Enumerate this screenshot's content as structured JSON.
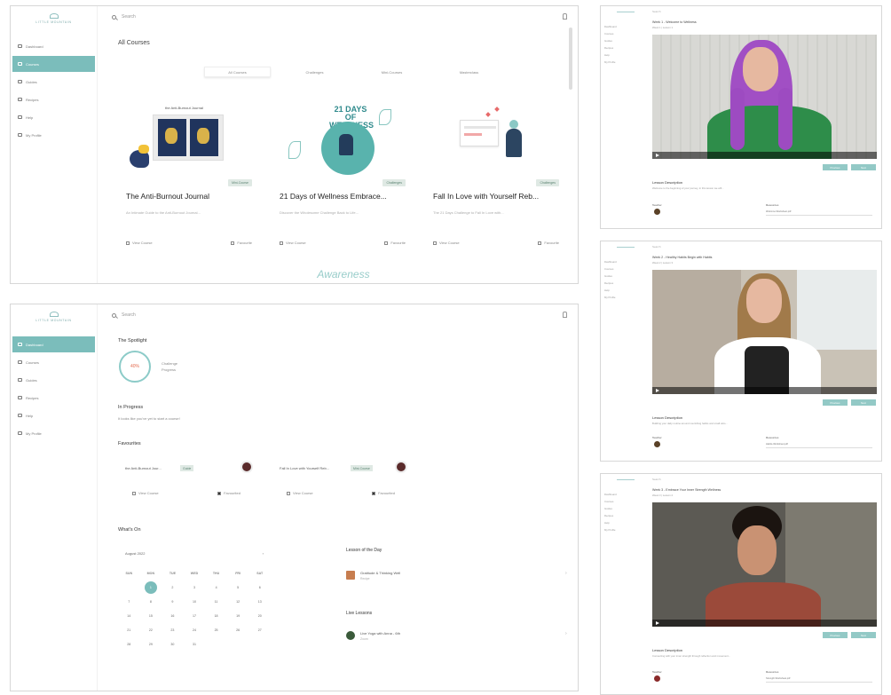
{
  "app": {
    "logo_text": "LITTLE MOUNTAIN"
  },
  "sidebar": {
    "items": [
      {
        "label": "Dashboard"
      },
      {
        "label": "Courses"
      },
      {
        "label": "Guides"
      },
      {
        "label": "Recipes"
      },
      {
        "label": "Help"
      },
      {
        "label": "My Profile"
      }
    ]
  },
  "search": {
    "placeholder": "Search"
  },
  "courses_page": {
    "heading": "All Courses",
    "tabs": [
      {
        "label": "All Courses",
        "active": true
      },
      {
        "label": "Challenges",
        "active": false
      },
      {
        "label": "Mini-Courses",
        "active": false
      },
      {
        "label": "Masterclass",
        "active": false
      }
    ],
    "cards": [
      {
        "art_caption": "the Anti-Burnout Journal",
        "badge": "Mini-Course",
        "title": "The Anti-Burnout Journal",
        "desc": "An Intimate Guide to the Anti-Burnout Journal...",
        "view_label": "View Course",
        "fav_label": "Favourite"
      },
      {
        "art_caption": "21 DAYS OF WELLNESS",
        "badge": "Challenges",
        "title": "21 Days of Wellness Embrace...",
        "desc": "Discover the Wholesome Challenge Back to Life...",
        "view_label": "View Course",
        "fav_label": "Favourite"
      },
      {
        "art_caption": "",
        "badge": "Challenges",
        "title": "Fall In Love with Yourself Reb...",
        "desc": "The 21 Days Challenge to Fall In Love with...",
        "view_label": "View Course",
        "fav_label": "Favourite"
      }
    ],
    "peek_row": [
      "Awareness"
    ]
  },
  "dashboard": {
    "spotlight_heading": "The Spotlight",
    "spotlight_percent": "40%",
    "spotlight_lines": [
      "Challenge",
      "Progress"
    ],
    "progress_heading": "In Progress",
    "progress_text": "It looks like you've yet to start a course!",
    "favourites_heading": "Favourites",
    "favourites": [
      {
        "title": "the Anti-Burnout Jour...",
        "badge": "Guide",
        "view_label": "View Course",
        "fav_label": "Favourited"
      },
      {
        "title": "Fall In Love with Yourself Reb...",
        "badge": "Mini-Course",
        "view_label": "View Course",
        "fav_label": "Favourited"
      }
    ],
    "calendar_heading": "What's On",
    "calendar": {
      "month": "August 2022",
      "weekdays": [
        "SUN",
        "MON",
        "TUE",
        "WED",
        "THU",
        "FRI",
        "SAT"
      ],
      "weeks": [
        [
          "",
          "1",
          "2",
          "3",
          "4",
          "5",
          "6"
        ],
        [
          "7",
          "8",
          "9",
          "10",
          "11",
          "12",
          "13"
        ],
        [
          "14",
          "15",
          "16",
          "17",
          "18",
          "19",
          "20"
        ],
        [
          "21",
          "22",
          "23",
          "24",
          "25",
          "26",
          "27"
        ],
        [
          "28",
          "29",
          "30",
          "31",
          "",
          "",
          ""
        ]
      ],
      "today": "1"
    },
    "lesson_heading": "Lesson of the Day",
    "lesson": {
      "title": "Gratitude & Thinking Well",
      "sub": "Recipe"
    },
    "live_heading": "Live Lessons",
    "live": {
      "title": "Live Yoga with Anna - 6th",
      "sub": "Zoom"
    }
  },
  "screens": [
    {
      "title": "Week 1 - Welcome to Wellness",
      "sub": "Week 1 | Lesson 1",
      "lesson_heading": "Lesson Description",
      "lesson_sub": "Welcome to the beginning of your journey, in this lesson we will...",
      "btn_prev": "Previous",
      "btn_next": "Next",
      "teacher_label": "Teacher",
      "res_label": "Resources",
      "res_value": "Welcome-Worksheet.pdf"
    },
    {
      "title": "Week 2 - Healthy Habits Begin with Habits",
      "sub": "Week 2 | Lesson 3",
      "lesson_heading": "Lesson Description",
      "lesson_sub": "Building your daily routine around nourishing habits and small wins...",
      "btn_prev": "Previous",
      "btn_next": "Next",
      "teacher_label": "Teacher",
      "res_label": "Resources",
      "res_value": "Habits-Worksheet.pdf"
    },
    {
      "title": "Week 3 - Embrace Your Inner Strength Wellness",
      "sub": "Week 3 | Lesson 2",
      "lesson_heading": "Lesson Description",
      "lesson_sub": "Connecting with your inner strength through reflection and movement...",
      "btn_prev": "Previous",
      "btn_next": "Next",
      "teacher_label": "Teacher",
      "res_label": "Resources",
      "res_value": "Strength-Worksheet.pdf"
    }
  ],
  "colors": {
    "accent": "#7bbdbb",
    "badge_bg": "#dfe9e4",
    "badge_text": "#58806f"
  }
}
